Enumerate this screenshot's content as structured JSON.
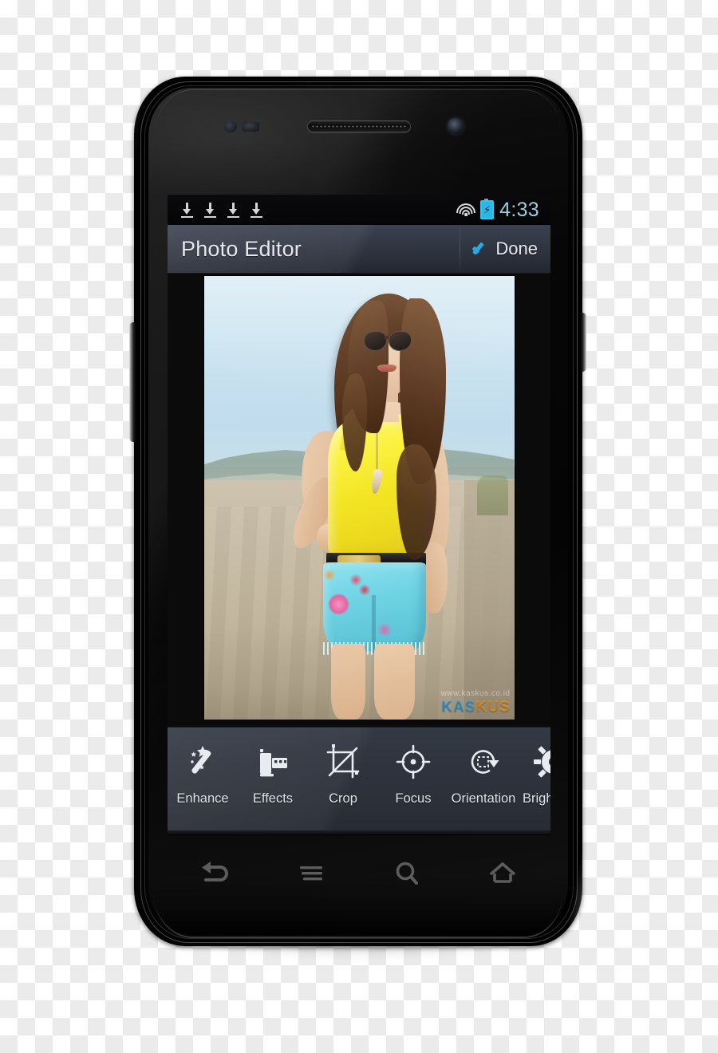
{
  "device": {
    "name": "android-smartphone",
    "hardware": {
      "earpiece": "earpiece-speaker",
      "front_camera": "front-camera",
      "proximity_sensor": "proximity-sensor",
      "volume_button": "volume-rocker",
      "power_button": "power-button"
    }
  },
  "status_bar": {
    "notification_icons": [
      {
        "name": "download-icon",
        "label": "Download"
      },
      {
        "name": "download-icon",
        "label": "Download"
      },
      {
        "name": "download-icon",
        "label": "Download"
      },
      {
        "name": "download-icon",
        "label": "Download"
      }
    ],
    "wifi": {
      "name": "wifi-icon",
      "label": "Wi-Fi connected"
    },
    "battery": {
      "name": "battery-charging-icon",
      "label": "Charging",
      "bolt": "⚡",
      "color": "#2ab7e4"
    },
    "time": "4:33",
    "time_color": "#9fc8dc"
  },
  "action_bar": {
    "title": "Photo Editor",
    "done_label": "Done",
    "check_color": "#2aa8e0"
  },
  "photo": {
    "alt": "Young woman in yellow tank top and light blue denim shorts standing outdoors",
    "watermark_small": "www.kaskus.co.id",
    "watermark": "KASKUS",
    "watermark_colors": [
      "#3fa9e0",
      "#f0a030"
    ]
  },
  "toolbar": {
    "tools": [
      {
        "label": "Enhance",
        "icon": "magic-wand-icon"
      },
      {
        "label": "Effects",
        "icon": "film-roll-icon"
      },
      {
        "label": "Crop",
        "icon": "crop-icon"
      },
      {
        "label": "Focus",
        "icon": "focus-target-icon"
      },
      {
        "label": "Orientation",
        "icon": "rotate-icon"
      },
      {
        "label": "Brightness",
        "icon": "brightness-gear-icon"
      }
    ]
  },
  "nav_bar": {
    "buttons": [
      {
        "name": "back-button",
        "label": "Back"
      },
      {
        "name": "menu-button",
        "label": "Menu"
      },
      {
        "name": "search-button",
        "label": "Search"
      },
      {
        "name": "home-button",
        "label": "Home"
      }
    ]
  }
}
